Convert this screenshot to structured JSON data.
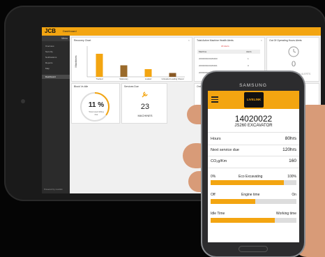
{
  "tablet": {
    "logo": "JCB",
    "app_title": "Dashboard",
    "sidebar": {
      "header": "Menu",
      "items": [
        "Overview",
        "Security",
        "Notifications",
        "Reports",
        "Map",
        "Dashboard"
      ],
      "footer": "Powered by Livelink"
    },
    "panels": {
      "recovery": {
        "title": "Recovery Chart",
        "y_label": "Machines"
      },
      "block_to_idle": {
        "title": "Block Vs Idle",
        "value": "11 %",
        "caption": "Total used Idling",
        "caption2": "Dot"
      },
      "services_due": {
        "title": "Services Due",
        "value": "23",
        "caption": "MACHINES"
      },
      "health": {
        "title": "Total Active Machine Health Alerts",
        "subtitle": "18 Alerts",
        "columns": [
          "Machine",
          "Alerts"
        ],
        "rows": [
          [
            "2000000020180460",
            "1"
          ],
          [
            "2000000020180461",
            "0"
          ],
          [
            "2000000020180462",
            "3"
          ]
        ]
      },
      "out_of_hours": {
        "title": "Out Of Operating Hours Alerts",
        "value": "0",
        "caption": "OUT OF OPERATION ALERTS"
      },
      "order": {
        "title": "Order calle"
      }
    }
  },
  "chart_data": {
    "type": "bar",
    "categories": [
      "Tracked",
      "Stationary",
      "Loaded",
      "Unloaded Loading Shovel"
    ],
    "values": [
      6,
      3,
      2,
      1
    ],
    "colors": [
      "#f3a511",
      "#9a6a2a",
      "#f3a511",
      "#8a5a26"
    ],
    "title": "Recovery Chart",
    "xlabel": "",
    "ylabel": "Machines",
    "ylim": [
      0,
      8
    ]
  },
  "phone": {
    "brand": "SAMSUNG",
    "logo": "LIVELINK",
    "machine_id": "14020022",
    "model": "JS260 EXCAVATOR",
    "stats": [
      {
        "label": "Hours",
        "value": "80hrs"
      },
      {
        "label": "Next service due",
        "value": "120hrs"
      },
      {
        "label": "CO₂g/Km",
        "value": "160"
      }
    ],
    "bars": [
      {
        "left": "0%",
        "center": "Eco Excavating",
        "right": "100%",
        "fill": 0.85
      },
      {
        "left": "Off",
        "center": "Engine time",
        "right": "On",
        "fill": 0.52
      },
      {
        "left": "Idle Time",
        "center": "",
        "right": "Working time",
        "fill": 0.75
      }
    ]
  },
  "colors": {
    "accent": "#f3a511",
    "dark": "#2b2b2b"
  }
}
